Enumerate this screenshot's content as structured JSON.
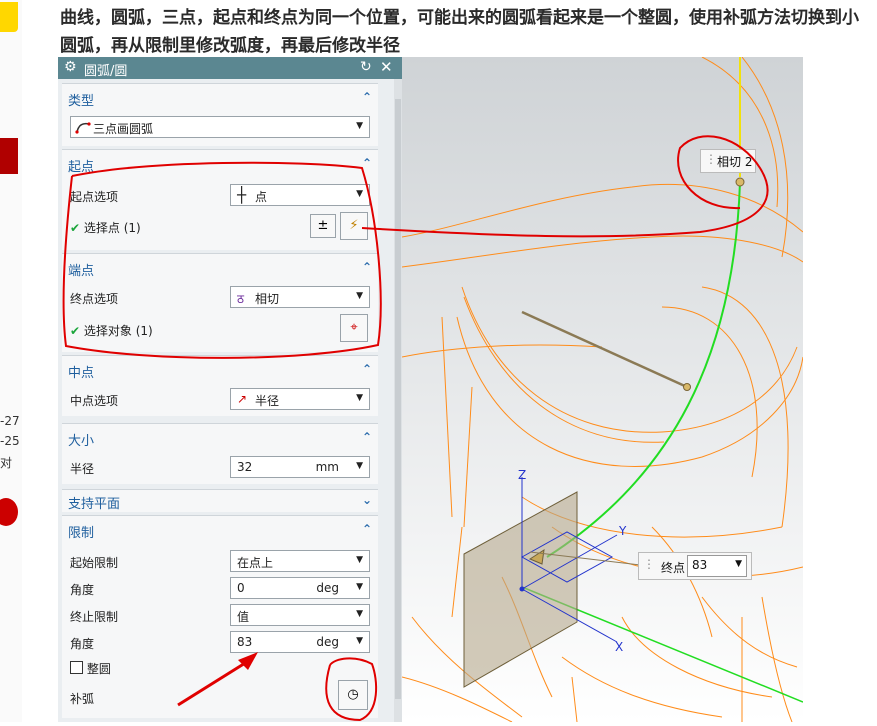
{
  "left_strip": {
    "dates": [
      "-27",
      "-25",
      "对"
    ]
  },
  "instruction": "曲线，圆弧，三点，起点和终点为同一个位置，可能出来的圆弧看起来是一个整圆，使用补弧方法切换到小圆弧，再从限制里修改弧度，再最后修改半径",
  "dialog": {
    "title": "圆弧/圆",
    "sections": {
      "type": {
        "header": "类型",
        "value": "三点画圆弧"
      },
      "start": {
        "header": "起点",
        "option_label": "起点选项",
        "option_value": "点",
        "select_label": "选择点 (1)"
      },
      "end": {
        "header": "端点",
        "option_label": "终点选项",
        "option_value": "相切",
        "select_label": "选择对象 (1)"
      },
      "mid": {
        "header": "中点",
        "option_label": "中点选项",
        "option_value": "半径"
      },
      "size": {
        "header": "大小",
        "radius_label": "半径",
        "radius_value": "32",
        "radius_unit": "mm"
      },
      "plane": {
        "header": "支持平面"
      },
      "limits": {
        "header": "限制",
        "start_limit_label": "起始限制",
        "start_limit_value": "在点上",
        "angle1_label": "角度",
        "angle1_value": "0",
        "angle1_unit": "deg",
        "end_limit_label": "终止限制",
        "end_limit_value": "值",
        "angle2_label": "角度",
        "angle2_value": "83",
        "angle2_unit": "deg",
        "full_circle_label": "整圆",
        "complement_label": "补弧"
      }
    }
  },
  "viewport": {
    "tangent_tag": "相切 2",
    "end_tag_label": "终点",
    "end_tag_value": "83",
    "axes": {
      "x": "X",
      "y": "Y",
      "z": "Z"
    }
  },
  "colors": {
    "title_bar": "#5b8791",
    "header_text": "#1f5f9e",
    "annotation": "#e00000",
    "wireframe": "#ff8c1a",
    "arc": "#22dd22"
  }
}
